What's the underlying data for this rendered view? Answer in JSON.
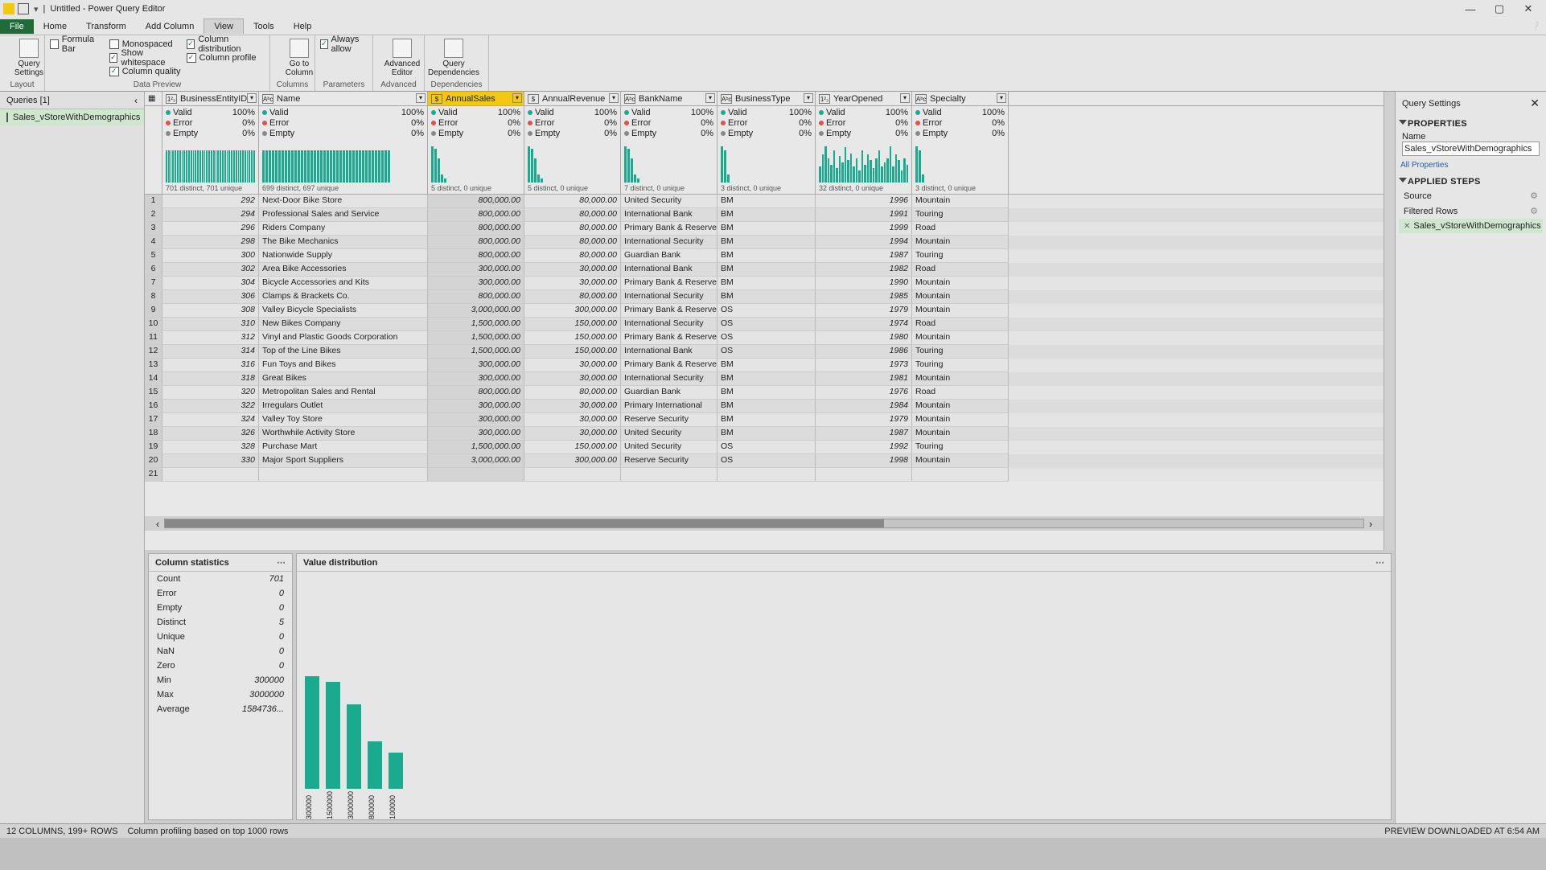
{
  "title": "Untitled - Power Query Editor",
  "menu": {
    "file": "File",
    "home": "Home",
    "transform": "Transform",
    "addcol": "Add Column",
    "view": "View",
    "tools": "Tools",
    "help": "Help"
  },
  "ribbon": {
    "querySettings": "Query\nSettings",
    "checks": {
      "formulaBar": "Formula Bar",
      "monospaced": "Monospaced",
      "columnDist": "Column distribution",
      "showWhite": "Show whitespace",
      "columnProfile": "Column profile",
      "columnQuality": "Column quality",
      "alwaysAllow": "Always allow"
    },
    "gotoCol": "Go to\nColumn",
    "advEditor": "Advanced\nEditor",
    "queryDeps": "Query\nDependencies",
    "groups": {
      "layout": "Layout",
      "dataPreview": "Data Preview",
      "columns": "Columns",
      "parameters": "Parameters",
      "advanced": "Advanced",
      "dependencies": "Dependencies"
    }
  },
  "queriesPane": {
    "title": "Queries [1]",
    "item": "Sales_vStoreWithDemographics"
  },
  "columns": [
    {
      "name": "BusinessEntityID",
      "type": "1²₃",
      "w": "w0",
      "num": true,
      "distinct": "701 distinct, 701 unique",
      "spark": "even"
    },
    {
      "name": "Name",
      "type": "Aᵇc",
      "w": "w1",
      "distinct": "699 distinct, 697 unique",
      "spark": "even"
    },
    {
      "name": "AnnualSales",
      "type": "$",
      "w": "w2",
      "num": true,
      "sel": true,
      "distinct": "5 distinct, 0 unique",
      "spark": "desc"
    },
    {
      "name": "AnnualRevenue",
      "type": "$",
      "w": "w3",
      "num": true,
      "distinct": "5 distinct, 0 unique",
      "spark": "desc"
    },
    {
      "name": "BankName",
      "type": "Aᵇc",
      "w": "w4",
      "distinct": "7 distinct, 0 unique",
      "spark": "desc"
    },
    {
      "name": "BusinessType",
      "type": "Aᵇc",
      "w": "w5",
      "distinct": "3 distinct, 0 unique",
      "spark": "three"
    },
    {
      "name": "YearOpened",
      "type": "1²₃",
      "w": "w6",
      "num": true,
      "distinct": "32 distinct, 0 unique",
      "spark": "varied"
    },
    {
      "name": "Specialty",
      "type": "Aᵇc",
      "w": "w7",
      "distinct": "3 distinct, 0 unique",
      "spark": "three"
    }
  ],
  "quality": {
    "valid": "Valid",
    "validPct": "100%",
    "error": "Error",
    "errorPct": "0%",
    "empty": "Empty",
    "emptyPct": "0%"
  },
  "rows": [
    {
      "n": 1,
      "id": 292,
      "name": "Next-Door Bike Store",
      "sales": "800,000.00",
      "rev": "80,000.00",
      "bank": "United Security",
      "bt": "BM",
      "yr": 1996,
      "sp": "Mountain"
    },
    {
      "n": 2,
      "id": 294,
      "name": "Professional Sales and Service",
      "sales": "800,000.00",
      "rev": "80,000.00",
      "bank": "International Bank",
      "bt": "BM",
      "yr": 1991,
      "sp": "Touring"
    },
    {
      "n": 3,
      "id": 296,
      "name": "Riders Company",
      "sales": "800,000.00",
      "rev": "80,000.00",
      "bank": "Primary Bank & Reserve",
      "bt": "BM",
      "yr": 1999,
      "sp": "Road"
    },
    {
      "n": 4,
      "id": 298,
      "name": "The Bike Mechanics",
      "sales": "800,000.00",
      "rev": "80,000.00",
      "bank": "International Security",
      "bt": "BM",
      "yr": 1994,
      "sp": "Mountain"
    },
    {
      "n": 5,
      "id": 300,
      "name": "Nationwide Supply",
      "sales": "800,000.00",
      "rev": "80,000.00",
      "bank": "Guardian Bank",
      "bt": "BM",
      "yr": 1987,
      "sp": "Touring"
    },
    {
      "n": 6,
      "id": 302,
      "name": "Area Bike Accessories",
      "sales": "300,000.00",
      "rev": "30,000.00",
      "bank": "International Bank",
      "bt": "BM",
      "yr": 1982,
      "sp": "Road"
    },
    {
      "n": 7,
      "id": 304,
      "name": "Bicycle Accessories and Kits",
      "sales": "300,000.00",
      "rev": "30,000.00",
      "bank": "Primary Bank & Reserve",
      "bt": "BM",
      "yr": 1990,
      "sp": "Mountain"
    },
    {
      "n": 8,
      "id": 306,
      "name": "Clamps & Brackets Co.",
      "sales": "800,000.00",
      "rev": "80,000.00",
      "bank": "International Security",
      "bt": "BM",
      "yr": 1985,
      "sp": "Mountain"
    },
    {
      "n": 9,
      "id": 308,
      "name": "Valley Bicycle Specialists",
      "sales": "3,000,000.00",
      "rev": "300,000.00",
      "bank": "Primary Bank & Reserve",
      "bt": "OS",
      "yr": 1979,
      "sp": "Mountain"
    },
    {
      "n": 10,
      "id": 310,
      "name": "New Bikes Company",
      "sales": "1,500,000.00",
      "rev": "150,000.00",
      "bank": "International Security",
      "bt": "OS",
      "yr": 1974,
      "sp": "Road"
    },
    {
      "n": 11,
      "id": 312,
      "name": "Vinyl and Plastic Goods Corporation",
      "sales": "1,500,000.00",
      "rev": "150,000.00",
      "bank": "Primary Bank & Reserve",
      "bt": "OS",
      "yr": 1980,
      "sp": "Mountain"
    },
    {
      "n": 12,
      "id": 314,
      "name": "Top of the Line Bikes",
      "sales": "1,500,000.00",
      "rev": "150,000.00",
      "bank": "International Bank",
      "bt": "OS",
      "yr": 1986,
      "sp": "Touring"
    },
    {
      "n": 13,
      "id": 316,
      "name": "Fun Toys and Bikes",
      "sales": "300,000.00",
      "rev": "30,000.00",
      "bank": "Primary Bank & Reserve",
      "bt": "BM",
      "yr": 1973,
      "sp": "Touring"
    },
    {
      "n": 14,
      "id": 318,
      "name": "Great Bikes",
      "sales": "300,000.00",
      "rev": "30,000.00",
      "bank": "International Security",
      "bt": "BM",
      "yr": 1981,
      "sp": "Mountain"
    },
    {
      "n": 15,
      "id": 320,
      "name": "Metropolitan Sales and Rental",
      "sales": "800,000.00",
      "rev": "80,000.00",
      "bank": "Guardian Bank",
      "bt": "BM",
      "yr": 1976,
      "sp": "Road"
    },
    {
      "n": 16,
      "id": 322,
      "name": "Irregulars Outlet",
      "sales": "300,000.00",
      "rev": "30,000.00",
      "bank": "Primary International",
      "bt": "BM",
      "yr": 1984,
      "sp": "Mountain"
    },
    {
      "n": 17,
      "id": 324,
      "name": "Valley Toy Store",
      "sales": "300,000.00",
      "rev": "30,000.00",
      "bank": "Reserve Security",
      "bt": "BM",
      "yr": 1979,
      "sp": "Mountain"
    },
    {
      "n": 18,
      "id": 326,
      "name": "Worthwhile Activity Store",
      "sales": "300,000.00",
      "rev": "30,000.00",
      "bank": "United Security",
      "bt": "BM",
      "yr": 1987,
      "sp": "Mountain"
    },
    {
      "n": 19,
      "id": 328,
      "name": "Purchase Mart",
      "sales": "1,500,000.00",
      "rev": "150,000.00",
      "bank": "United Security",
      "bt": "OS",
      "yr": 1992,
      "sp": "Touring"
    },
    {
      "n": 20,
      "id": 330,
      "name": "Major Sport Suppliers",
      "sales": "3,000,000.00",
      "rev": "300,000.00",
      "bank": "Reserve Security",
      "bt": "OS",
      "yr": 1998,
      "sp": "Mountain"
    },
    {
      "n": 21,
      "id": "",
      "name": "",
      "sales": "",
      "rev": "",
      "bank": "",
      "bt": "",
      "yr": "",
      "sp": ""
    }
  ],
  "stats": {
    "title": "Column statistics",
    "items": [
      [
        "Count",
        "701"
      ],
      [
        "Error",
        "0"
      ],
      [
        "Empty",
        "0"
      ],
      [
        "Distinct",
        "5"
      ],
      [
        "Unique",
        "0"
      ],
      [
        "NaN",
        "0"
      ],
      [
        "Zero",
        "0"
      ],
      [
        "Min",
        "300000"
      ],
      [
        "Max",
        "3000000"
      ],
      [
        "Average",
        "1584736..."
      ]
    ]
  },
  "chart_data": {
    "type": "bar",
    "title": "Value distribution",
    "categories": [
      "300000",
      "1500000",
      "3000000",
      "800000",
      "100000"
    ],
    "values": [
      200,
      190,
      150,
      85,
      65
    ],
    "xlabel": "",
    "ylabel": ""
  },
  "qs": {
    "title": "Query Settings",
    "properties": "PROPERTIES",
    "nameLbl": "Name",
    "name": "Sales_vStoreWithDemographics",
    "allProps": "All Properties",
    "applied": "APPLIED STEPS",
    "steps": [
      "Source",
      "Filtered Rows",
      "Sales_vStoreWithDemographics"
    ]
  },
  "status": {
    "left": "12 COLUMNS, 199+ ROWS",
    "mid": "Column profiling based on top 1000 rows",
    "right": "PREVIEW DOWNLOADED AT 6:54 AM"
  }
}
